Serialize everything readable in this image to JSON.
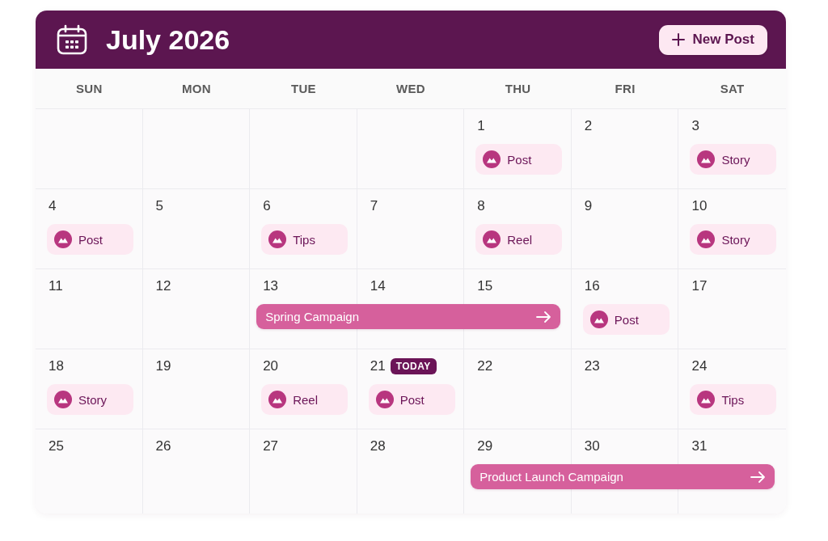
{
  "header": {
    "title": "July 2026",
    "new_post_button": {
      "label": "New Post"
    }
  },
  "weekdays": [
    "SUN",
    "MON",
    "TUE",
    "WED",
    "THU",
    "FRI",
    "SAT"
  ],
  "weeks": [
    {
      "days": [
        {
          "kind": "empty"
        },
        {
          "kind": "empty"
        },
        {
          "kind": "empty"
        },
        {
          "kind": "empty"
        },
        {
          "kind": "day",
          "date": "1",
          "events": [
            {
              "label": "Post"
            }
          ]
        },
        {
          "kind": "day",
          "date": "2"
        },
        {
          "kind": "day",
          "date": "3",
          "events": [
            {
              "label": "Story"
            }
          ]
        }
      ]
    },
    {
      "days": [
        {
          "kind": "day",
          "date": "4",
          "events": [
            {
              "label": "Post"
            }
          ]
        },
        {
          "kind": "day",
          "date": "5"
        },
        {
          "kind": "day",
          "date": "6",
          "events": [
            {
              "label": "Tips"
            }
          ]
        },
        {
          "kind": "day",
          "date": "7"
        },
        {
          "kind": "day",
          "date": "8",
          "events": [
            {
              "label": "Reel"
            }
          ]
        },
        {
          "kind": "day",
          "date": "9"
        },
        {
          "kind": "day",
          "date": "10",
          "events": [
            {
              "label": "Story"
            }
          ]
        }
      ]
    },
    {
      "days": [
        {
          "kind": "day",
          "date": "11"
        },
        {
          "kind": "day",
          "date": "12"
        },
        {
          "kind": "campaign",
          "label": "Spring Campaign",
          "days": [
            {
              "kind": "day",
              "date": "13"
            },
            {
              "kind": "day",
              "date": "14"
            },
            {
              "kind": "day",
              "date": "15"
            }
          ]
        },
        {
          "kind": "day",
          "date": "16",
          "events": [
            {
              "label": "Post"
            }
          ]
        },
        {
          "kind": "day",
          "date": "17"
        }
      ]
    },
    {
      "days": [
        {
          "kind": "day",
          "date": "18",
          "events": [
            {
              "label": "Story"
            }
          ]
        },
        {
          "kind": "day",
          "date": "19"
        },
        {
          "kind": "day",
          "date": "20",
          "events": [
            {
              "label": "Reel"
            }
          ]
        },
        {
          "kind": "day",
          "date": "21",
          "badge": "TODAY",
          "events": [
            {
              "label": "Post"
            }
          ]
        },
        {
          "kind": "day",
          "date": "22"
        },
        {
          "kind": "day",
          "date": "23"
        },
        {
          "kind": "day",
          "date": "24",
          "events": [
            {
              "label": "Tips"
            }
          ]
        }
      ]
    },
    {
      "days": [
        {
          "kind": "day",
          "date": "25"
        },
        {
          "kind": "day",
          "date": "26"
        },
        {
          "kind": "day",
          "date": "27"
        },
        {
          "kind": "day",
          "date": "28"
        },
        {
          "kind": "campaign",
          "label": "Product Launch Campaign",
          "days": [
            {
              "kind": "day",
              "date": "29"
            },
            {
              "kind": "day",
              "date": "30"
            },
            {
              "kind": "day",
              "date": "31"
            }
          ]
        }
      ]
    }
  ]
}
